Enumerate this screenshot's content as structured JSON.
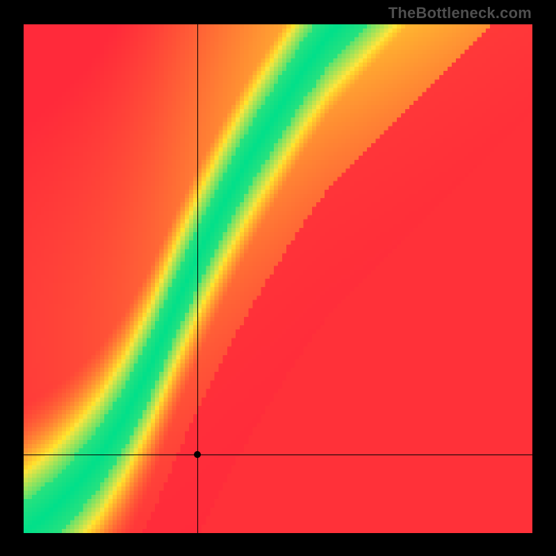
{
  "watermark": "TheBottleneck.com",
  "chart_data": {
    "type": "heatmap",
    "title": "",
    "xlabel": "",
    "ylabel": "",
    "xlim": [
      0,
      100
    ],
    "ylim": [
      0,
      100
    ],
    "grid": false,
    "legend": false,
    "color_scale": {
      "min_color": "#ff2a3a",
      "mid_color": "#ffe54a",
      "max_color": "#00e08a",
      "mapping": "match(x,y)  0=worst(red) .. 1=best(green)"
    },
    "optimal_band": {
      "description": "green diagonal band where GPU and CPU are balanced; curves low near origin then approaches slope ~1.8",
      "approx_points_xy": [
        [
          0,
          0
        ],
        [
          5,
          4
        ],
        [
          10,
          9
        ],
        [
          15,
          15
        ],
        [
          20,
          23
        ],
        [
          25,
          33
        ],
        [
          30,
          45
        ],
        [
          35,
          56
        ],
        [
          40,
          66
        ],
        [
          45,
          75
        ],
        [
          50,
          83
        ],
        [
          55,
          91
        ],
        [
          60,
          98
        ],
        [
          62,
          100
        ]
      ],
      "band_halfwidth_y": 6
    },
    "selected_point": {
      "x": 34.2,
      "y": 15.5
    },
    "crosshair": {
      "x": 34.2,
      "y": 15.5
    },
    "pixel_grid": 120,
    "pixelated": true
  }
}
